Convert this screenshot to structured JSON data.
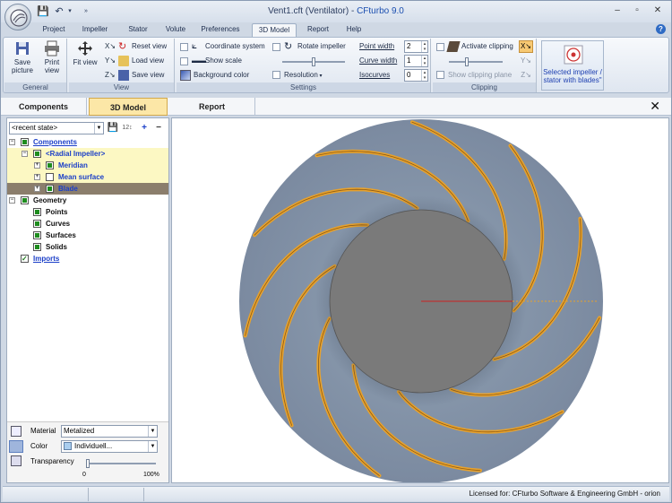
{
  "titlebar": {
    "document": "Vent1.cft (Ventilator)",
    "separator": " - ",
    "app_name": "CFturbo 9.0"
  },
  "menu_tabs": [
    "Project",
    "Impeller",
    "Stator",
    "Volute",
    "Preferences",
    "3D Model",
    "Report",
    "Help"
  ],
  "active_menu_tab": "3D Model",
  "ribbon": {
    "general": {
      "label": "General",
      "save_picture": "Save picture",
      "print_view": "Print view"
    },
    "view": {
      "label": "View",
      "fit_view": "Fit view",
      "reset_view": "Reset view",
      "load_view": "Load view",
      "save_view": "Save view"
    },
    "settings": {
      "label": "Settings",
      "coordinate_system": "Coordinate system",
      "rotate_impeller": "Rotate impeller",
      "show_scale": "Show scale",
      "background_color": "Background color",
      "resolution": "Resolution",
      "point_width_label": "Point width",
      "point_width": "2",
      "curve_width_label": "Curve width",
      "curve_width": "1",
      "isocurves_label": "Isocurves",
      "isocurves": "0"
    },
    "clipping": {
      "label": "Clipping",
      "activate_clipping": "Activate clipping",
      "show_clipping_plane": "Show clipping plane"
    },
    "selected_component": "Selected impeller / stator with blades\""
  },
  "view_tabs": [
    "Components",
    "3D Model",
    "Report"
  ],
  "active_view_tab": "3D Model",
  "state_combo": "<recent state>",
  "tree": [
    {
      "label": "Components",
      "level": 0,
      "style": "link",
      "checkbox": "on",
      "expander": "−"
    },
    {
      "label": "<Radial Impeller>",
      "level": 1,
      "style": "blue",
      "checkbox": "on",
      "expander": "−",
      "highlight": true
    },
    {
      "label": "Meridian",
      "level": 2,
      "style": "blue",
      "checkbox": "on",
      "expander": "+",
      "highlight": true
    },
    {
      "label": "Mean surface",
      "level": 2,
      "style": "blue",
      "checkbox": "off",
      "expander": "+",
      "highlight": true
    },
    {
      "label": "Blade",
      "level": 2,
      "style": "blue",
      "checkbox": "on",
      "expander": "+",
      "selected": true
    },
    {
      "label": "Geometry",
      "level": 0,
      "style": "blk",
      "checkbox": "on",
      "expander": "−"
    },
    {
      "label": "Points",
      "level": 1,
      "style": "blk",
      "checkbox": "on"
    },
    {
      "label": "Curves",
      "level": 1,
      "style": "blk",
      "checkbox": "on"
    },
    {
      "label": "Surfaces",
      "level": 1,
      "style": "blk",
      "checkbox": "on"
    },
    {
      "label": "Solids",
      "level": 1,
      "style": "blk",
      "checkbox": "on"
    },
    {
      "label": "Imports",
      "level": 0,
      "style": "link",
      "checkbox": "chk"
    }
  ],
  "properties": {
    "material_label": "Material",
    "material": "Metalized",
    "color_label": "Color",
    "color": "Individuell...",
    "transparency_label": "Transparency",
    "transparency_min": "0",
    "transparency_max": "100%",
    "transparency_value": 0
  },
  "model": {
    "blade_count": 11,
    "colors": {
      "disk": "#7e8fa3",
      "hub": "#7a7a7a",
      "blade": "#e8a22c",
      "axis": "#cc2222"
    }
  },
  "status": {
    "license": "Licensed for: CFturbo Software & Engineering GmbH - orion"
  }
}
